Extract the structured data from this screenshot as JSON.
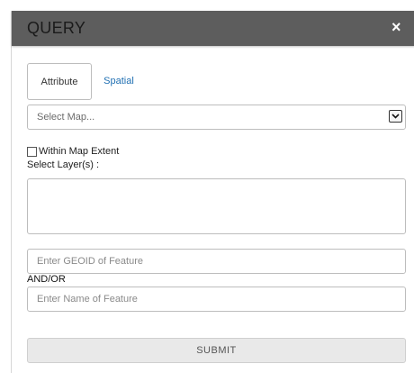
{
  "dialog": {
    "title": "QUERY",
    "close_label": "×"
  },
  "tabs": [
    {
      "label": "Attribute",
      "active": true
    },
    {
      "label": "Spatial",
      "active": false
    }
  ],
  "map_select": {
    "value": "Select Map..."
  },
  "within_extent": {
    "label": "Within Map Extent",
    "checked": false
  },
  "layers": {
    "label": "Select Layer(s) :"
  },
  "geoid_input": {
    "placeholder": "Enter GEOID of Feature",
    "value": ""
  },
  "andor_label": "AND/OR",
  "name_input": {
    "placeholder": "Enter Name of Feature",
    "value": ""
  },
  "submit_label": "SUBMIT",
  "colors": {
    "titlebar": "#5d5d5d",
    "link": "#1f6fb2"
  }
}
